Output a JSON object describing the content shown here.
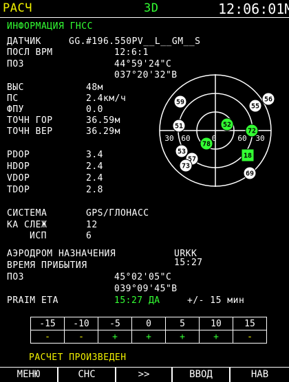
{
  "header": {
    "mode": "РАСЧ",
    "dim": "3D",
    "time": "12:06:01М"
  },
  "title": "ИНФОРМАЦИЯ ГНСС",
  "sensor": {
    "label": "ДАТЧИК",
    "value": "GG.#196.550PV__L__GM__S"
  },
  "last_time": {
    "label": "ПОСЛ ВРМ",
    "value": "12:6:1"
  },
  "position": {
    "label": "ПОЗ",
    "lat": "44°59'24\"С",
    "lon": "037°20'32\"В"
  },
  "alt": {
    "label": "ВЫС",
    "value": "48м"
  },
  "gs": {
    "label": "ПС",
    "value": "2.4км/ч"
  },
  "track": {
    "label": "ФПУ",
    "value": "0.0"
  },
  "hacc": {
    "label": "ТОЧН ГОР",
    "value": "36.59м"
  },
  "vacc": {
    "label": "ТОЧН ВЕР",
    "value": "36.29м"
  },
  "dop": [
    {
      "label": "PDOP",
      "value": "3.4"
    },
    {
      "label": "HDOP",
      "value": "2.4"
    },
    {
      "label": "VDOP",
      "value": "2.4"
    },
    {
      "label": "TDOP",
      "value": "2.8"
    }
  ],
  "system": {
    "label": "СИСТЕМА",
    "value": "GPS/ГЛОНАСС"
  },
  "tracked": {
    "label": "КА СЛЕЖ",
    "value": "12"
  },
  "used": {
    "label": "ИСП",
    "value": "6"
  },
  "dest": {
    "label": "АЭРОДРОМ НАЗНАЧЕНИЯ",
    "value": "URKK"
  },
  "eta": {
    "label": "ВРЕМЯ ПРИБЫТИЯ",
    "value": "15:27"
  },
  "dest_pos": {
    "label": "ПОЗ",
    "lat": "45°02'05\"С",
    "lon": "039°09'45\"В"
  },
  "praim": {
    "label": "PRAIM ETA",
    "value": "15:27 ДА",
    "tolerance": "+/- 15 мин"
  },
  "raim_table": {
    "offsets": [
      "-15",
      "-10",
      "-5",
      "0",
      "5",
      "10",
      "15"
    ],
    "status": [
      "-",
      "-",
      "+",
      "+",
      "+",
      "+",
      "-"
    ]
  },
  "status_message": "РАСЧЕТ ПРОИЗВЕДЕН",
  "softkeys": [
    "МЕНЮ",
    "СНС",
    ">>",
    "ВВОД",
    "НАВ"
  ],
  "skyplot": {
    "ring_labels": [
      "30",
      "60",
      "0",
      "60",
      "30"
    ],
    "satellites": [
      {
        "id": "59",
        "used": false,
        "shape": "circle"
      },
      {
        "id": "55",
        "used": false,
        "shape": "circle"
      },
      {
        "id": "56",
        "used": false,
        "shape": "circle"
      },
      {
        "id": "51",
        "used": false,
        "shape": "circle"
      },
      {
        "id": "52",
        "used": true,
        "shape": "circle"
      },
      {
        "id": "72",
        "used": true,
        "shape": "circle"
      },
      {
        "id": "78",
        "used": true,
        "shape": "circle"
      },
      {
        "id": "53",
        "used": false,
        "shape": "circle"
      },
      {
        "id": "57",
        "used": false,
        "shape": "circle"
      },
      {
        "id": "73",
        "used": false,
        "shape": "circle"
      },
      {
        "id": "18",
        "used": true,
        "shape": "square"
      },
      {
        "id": "69",
        "used": false,
        "shape": "circle"
      }
    ],
    "colors": {
      "used": "#33ff33",
      "unused": "#ffffff",
      "ring": "#ffffff"
    }
  }
}
